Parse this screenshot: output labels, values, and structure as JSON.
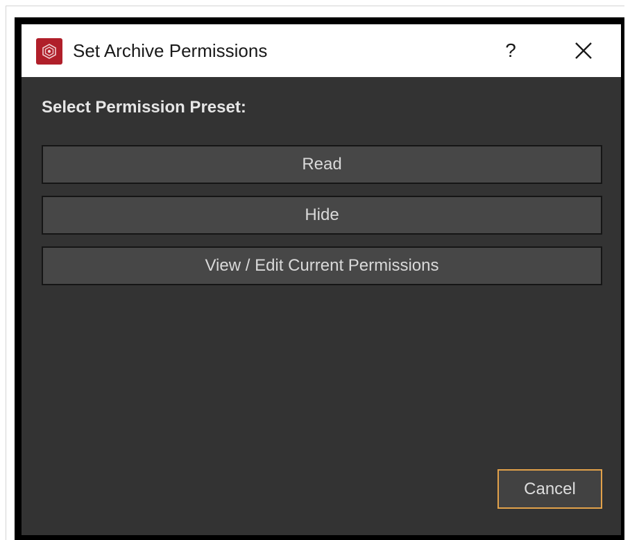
{
  "window": {
    "title": "Set Archive Permissions",
    "help_label": "?",
    "icons": {
      "app": "app-logo-icon",
      "close": "close-icon"
    }
  },
  "content": {
    "section_label": "Select Permission Preset:",
    "presets": [
      {
        "label": "Read"
      },
      {
        "label": "Hide"
      },
      {
        "label": "View / Edit Current Permissions"
      }
    ]
  },
  "footer": {
    "cancel_label": "Cancel"
  },
  "colors": {
    "titlebar_bg": "#ffffff",
    "body_bg": "#333333",
    "button_bg": "#474747",
    "app_icon_bg": "#b01f2a",
    "focus_border": "#e3a24a"
  }
}
